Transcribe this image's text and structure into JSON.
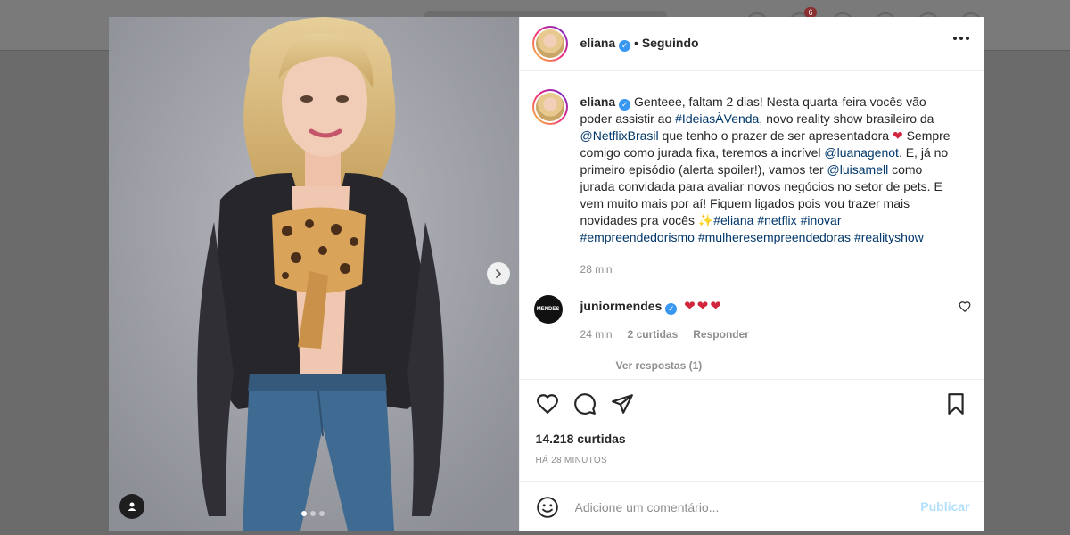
{
  "post": {
    "username": "eliana",
    "separator": "•",
    "follow_status": "Seguindo",
    "caption_segments": [
      {
        "t": "Genteee, faltam 2 dias! Nesta quarta-feira vocês vão poder assistir ao ",
        "k": "text"
      },
      {
        "t": "#IdeiasÀVenda",
        "k": "tag"
      },
      {
        "t": ", novo reality show brasileiro da ",
        "k": "text"
      },
      {
        "t": "@NetflixBrasil",
        "k": "tag"
      },
      {
        "t": " que tenho o prazer de ser apresentadora ",
        "k": "text"
      },
      {
        "t": "❤",
        "k": "heart"
      },
      {
        "t": " Sempre comigo como jurada fixa, teremos a incrível ",
        "k": "text"
      },
      {
        "t": "@luanagenot",
        "k": "tag"
      },
      {
        "t": ". E, já no primeiro episódio (alerta spoiler!), vamos ter ",
        "k": "text"
      },
      {
        "t": "@luisamell",
        "k": "tag"
      },
      {
        "t": " como jurada convidada para avaliar novos negócios no setor de pets. E vem muito mais por aí! Fiquem ligados pois vou trazer mais novidades pra vocês ✨",
        "k": "text"
      },
      {
        "t": "#eliana",
        "k": "tag"
      },
      {
        "t": " ",
        "k": "text"
      },
      {
        "t": "#netflix",
        "k": "tag"
      },
      {
        "t": " ",
        "k": "text"
      },
      {
        "t": "#inovar",
        "k": "tag"
      },
      {
        "t": " ",
        "k": "text"
      },
      {
        "t": "#empreendedorismo",
        "k": "tag"
      },
      {
        "t": " ",
        "k": "text"
      },
      {
        "t": "#mulheresempreendedoras",
        "k": "tag"
      },
      {
        "t": " ",
        "k": "text"
      },
      {
        "t": "#realityshow",
        "k": "tag"
      }
    ],
    "caption_time": "28 min",
    "likes": "14.218 curtidas",
    "posted_ago": "HÁ 28 MINUTOS"
  },
  "comment": {
    "avatar_text": "MENDES",
    "username": "juniormendes",
    "hearts": "❤❤❤",
    "time": "24 min",
    "likes": "2 curtidas",
    "reply": "Responder",
    "view_replies": "Ver respostas (1)"
  },
  "composer": {
    "placeholder": "Adicione um comentário...",
    "publish_label": "Publicar"
  },
  "colors": {
    "accent": "#3897f0",
    "link": "#00376b",
    "heart": "#d1263d",
    "publish_disabled": "#b2dffc"
  },
  "icons": [
    "more-icon",
    "chevron-right-icon",
    "user-tag-icon",
    "heart-icon",
    "comment-icon",
    "share-icon",
    "bookmark-icon",
    "emoji-icon",
    "verified-icon"
  ],
  "carousel": {
    "total": 3,
    "active": 1
  },
  "background_badge": "6"
}
